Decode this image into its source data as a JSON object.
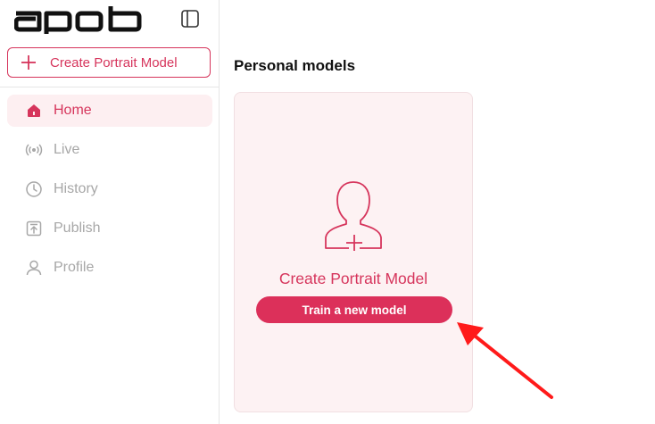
{
  "sidebar": {
    "brand": "apob",
    "create_button": {
      "label": "Create Portrait Model",
      "icon": "plus-icon"
    },
    "items": [
      {
        "label": "Home",
        "icon": "home-icon",
        "active": true
      },
      {
        "label": "Live",
        "icon": "broadcast-icon",
        "active": false
      },
      {
        "label": "History",
        "icon": "clock-icon",
        "active": false
      },
      {
        "label": "Publish",
        "icon": "upload-icon",
        "active": false
      },
      {
        "label": "Profile",
        "icon": "user-icon",
        "active": false
      }
    ]
  },
  "main": {
    "section_title": "Personal models",
    "create_card": {
      "title": "Create Portrait Model",
      "button_label": "Train a new model",
      "icon": "portrait-plus-icon"
    }
  },
  "annotation": {
    "icon": "red-arrow-icon",
    "color": "#ff1a1a"
  },
  "colors": {
    "accent": "#d6355c",
    "button_fill": "#dc305a",
    "active_bg": "#fdeff1",
    "card_bg": "#fdf2f3",
    "muted_text": "#a7a7a7"
  }
}
